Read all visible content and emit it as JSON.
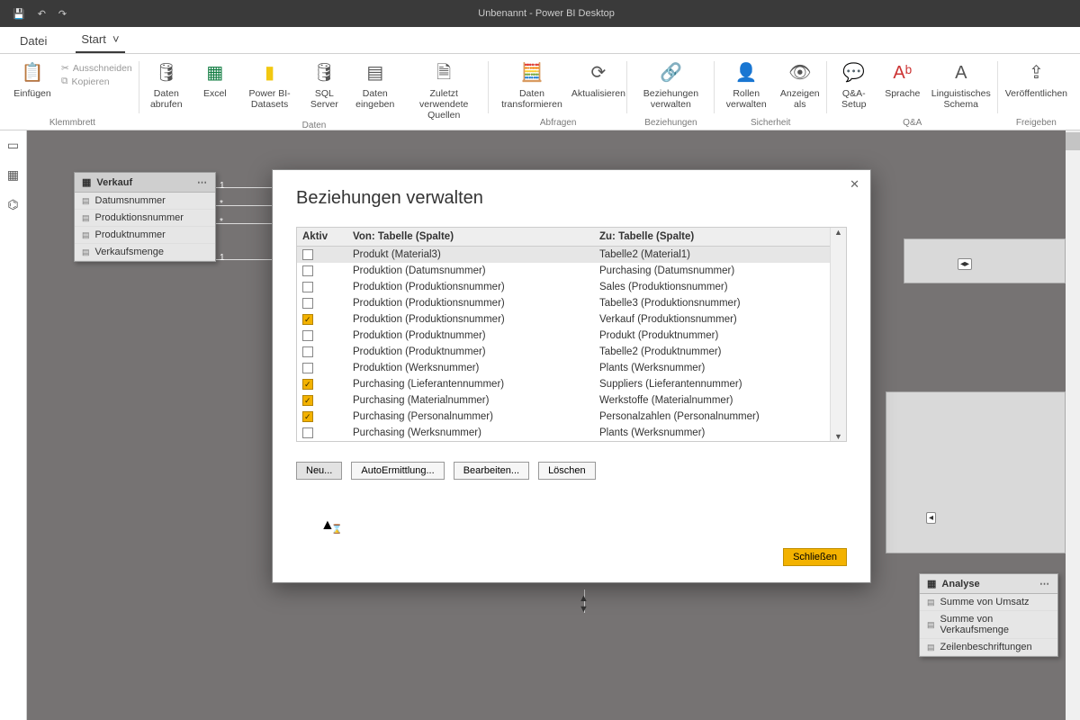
{
  "title_bar": {
    "document_title": "Unbenannt - Power BI Desktop"
  },
  "tabs": {
    "file": "Datei",
    "start": "Start"
  },
  "ribbon": {
    "clipboard": {
      "group": "Klemmbrett",
      "paste": "Einfügen",
      "cut": "Ausschneiden",
      "copy": "Kopieren"
    },
    "data": {
      "group": "Daten",
      "get": "Daten abrufen",
      "excel": "Excel",
      "pbi": "Power BI-Datasets",
      "sql": "SQL Server",
      "enter": "Daten eingeben",
      "recent": "Zuletzt verwendete Quellen"
    },
    "queries": {
      "group": "Abfragen",
      "transform": "Daten transformieren",
      "refresh": "Aktualisieren"
    },
    "relations": {
      "group": "Beziehungen",
      "manage": "Beziehungen verwalten"
    },
    "security": {
      "group": "Sicherheit",
      "roles": "Rollen verwalten",
      "viewas": "Anzeigen als"
    },
    "qna": {
      "group": "Q&A",
      "setup": "Q&A-Setup",
      "language": "Sprache",
      "schema": "Linguistisches Schema"
    },
    "share": {
      "group": "Freigeben",
      "publish": "Veröffentlichen"
    }
  },
  "verkauf_card": {
    "title": "Verkauf",
    "fields": [
      "Datumsnummer",
      "Produktionsnummer",
      "Produktnummer",
      "Verkaufsmenge"
    ]
  },
  "analyse_card": {
    "title": "Analyse",
    "fields": [
      "Summe von Umsatz",
      "Summe von Verkaufsmenge",
      "Zeilenbeschriftungen"
    ]
  },
  "relation_labels": {
    "one_a": "1",
    "many_a": "*",
    "one_b": "1",
    "many_b": "*"
  },
  "dialog": {
    "title": "Beziehungen verwalten",
    "columns": {
      "active": "Aktiv",
      "from": "Von: Tabelle (Spalte)",
      "to": "Zu: Tabelle (Spalte)"
    },
    "rows": [
      {
        "active": false,
        "from": "Produkt (Material3)",
        "to": "Tabelle2 (Material1)",
        "selected": true
      },
      {
        "active": false,
        "from": "Produktion (Datumsnummer)",
        "to": "Purchasing (Datumsnummer)"
      },
      {
        "active": false,
        "from": "Produktion (Produktionsnummer)",
        "to": "Sales (Produktionsnummer)"
      },
      {
        "active": false,
        "from": "Produktion (Produktionsnummer)",
        "to": "Tabelle3 (Produktionsnummer)"
      },
      {
        "active": true,
        "from": "Produktion (Produktionsnummer)",
        "to": "Verkauf (Produktionsnummer)"
      },
      {
        "active": false,
        "from": "Produktion (Produktnummer)",
        "to": "Produkt (Produktnummer)"
      },
      {
        "active": false,
        "from": "Produktion (Produktnummer)",
        "to": "Tabelle2 (Produktnummer)"
      },
      {
        "active": false,
        "from": "Produktion (Werksnummer)",
        "to": "Plants (Werksnummer)"
      },
      {
        "active": true,
        "from": "Purchasing (Lieferantennummer)",
        "to": "Suppliers (Lieferantennummer)"
      },
      {
        "active": true,
        "from": "Purchasing (Materialnummer)",
        "to": "Werkstoffe (Materialnummer)"
      },
      {
        "active": true,
        "from": "Purchasing (Personalnummer)",
        "to": "Personalzahlen (Personalnummer)"
      },
      {
        "active": false,
        "from": "Purchasing (Werksnummer)",
        "to": "Plants (Werksnummer)"
      }
    ],
    "buttons": {
      "new": "Neu...",
      "auto": "AutoErmittlung...",
      "edit": "Bearbeiten...",
      "delete": "Löschen",
      "close": "Schließen"
    }
  }
}
